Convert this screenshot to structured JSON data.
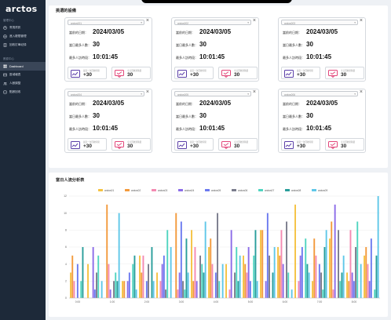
{
  "app": {
    "logo": "arctos"
  },
  "sidebar": {
    "sections": [
      {
        "label": "管理中心",
        "items": [
          {
            "label": "會員資訊",
            "icon": "user-icon"
          },
          {
            "label": "進入權限管理",
            "icon": "key-icon"
          },
          {
            "label": "回收訂單紀錄",
            "icon": "receipt-icon"
          }
        ]
      },
      {
        "label": "數據中心",
        "items": [
          {
            "label": "Dashboard",
            "icon": "dashboard-icon",
            "active": true
          },
          {
            "label": "區域報表",
            "icon": "report-icon"
          },
          {
            "label": "人數調整",
            "icon": "people-icon"
          },
          {
            "label": "點數回收",
            "icon": "recycle-icon"
          }
        ]
      }
    ]
  },
  "devices_panel": {
    "title": "挑選的設備",
    "labels": {
      "time": "當前的日期：",
      "visitors": "當日最多人數：",
      "peak": "最多人訪時段："
    },
    "cards": [
      {
        "device": "arctos001",
        "date": "2024/03/05",
        "visitors": "30",
        "peak": "10:01:45",
        "left_caption": "最近一次回收時間",
        "left_value": "+30",
        "right_caption": "今日回收累積量",
        "right_value": "30"
      },
      {
        "device": "arctos002",
        "date": "2024/03/05",
        "visitors": "30",
        "peak": "10:01:45",
        "left_caption": "最近一次回收時間",
        "left_value": "+30",
        "right_caption": "今日回收累積量",
        "right_value": "30"
      },
      {
        "device": "arctos003",
        "date": "2024/03/05",
        "visitors": "30",
        "peak": "10:01:45",
        "left_caption": "最近一次回收時間",
        "left_value": "+30",
        "right_caption": "今日回收累積量",
        "right_value": "30"
      },
      {
        "device": "arctos004",
        "date": "2024/03/05",
        "visitors": "30",
        "peak": "10:01:45",
        "left_caption": "最近一次回收時間",
        "left_value": "+30",
        "right_caption": "今日回收累積量",
        "right_value": "30"
      },
      {
        "device": "arctos005",
        "date": "2024/03/05",
        "visitors": "30",
        "peak": "10:01:45",
        "left_caption": "最近一次回收時間",
        "left_value": "+30",
        "right_caption": "今日回收累積量",
        "right_value": "30"
      },
      {
        "device": "arctos006",
        "date": "2024/03/05",
        "visitors": "30",
        "peak": "10:01:45",
        "left_caption": "最近一次回收時間",
        "left_value": "+30",
        "right_caption": "今日回收累積量",
        "right_value": "30"
      }
    ]
  },
  "chart_panel": {
    "title": "當日人流分析表"
  },
  "colors": {
    "sidebar_bg": "#1d2939",
    "accent_purple": "#5b3fa8",
    "accent_pink": "#e2467a",
    "series": [
      "#f5c242",
      "#f39a3c",
      "#f48ab2",
      "#8b6ce8",
      "#6b79ef",
      "#7a7c8c",
      "#4fd4c0",
      "#2a9e9b",
      "#5fc7e8"
    ]
  },
  "chart_data": {
    "type": "bar",
    "title": "",
    "xlabel": "",
    "ylabel": "",
    "ylim": [
      0,
      12
    ],
    "yticks": [
      0,
      2,
      4,
      6,
      8,
      10,
      12
    ],
    "categories": [
      "1:00",
      "2:00",
      "3:00",
      "4:00",
      "5:00",
      "6:00",
      "7:00",
      "8:00",
      "9:00",
      "10:00",
      "11:00",
      "12:00",
      "13:00",
      "14:00",
      "15:00",
      "16:00",
      "17:00",
      "18:00"
    ],
    "category_labels": [
      "0:00",
      "",
      "1:00",
      "",
      "2:00",
      "",
      "3:00",
      "",
      "4:00",
      "",
      "5:00",
      "",
      "6:00",
      "",
      "7:00",
      "",
      "8:00",
      ""
    ],
    "series": [
      {
        "name": "arctos01",
        "values": [
          3,
          4,
          0,
          2,
          5,
          3,
          0,
          8,
          6,
          4,
          5,
          8,
          6,
          11,
          2,
          7,
          3,
          5
        ]
      },
      {
        "name": "arctos02",
        "values": [
          5,
          0,
          11,
          2,
          3,
          0,
          10,
          2,
          7,
          0,
          4,
          8,
          5,
          0,
          7,
          9,
          2,
          6
        ]
      },
      {
        "name": "arctos03",
        "values": [
          2,
          0,
          4,
          0,
          5,
          2,
          1,
          6,
          4,
          1,
          3,
          0,
          8,
          2,
          5,
          1,
          8,
          4
        ]
      },
      {
        "name": "arctos04",
        "values": [
          0,
          6,
          1,
          2,
          0,
          4,
          3,
          2,
          0,
          8,
          6,
          2,
          4,
          5,
          0,
          11,
          3,
          2
        ]
      },
      {
        "name": "arctos05",
        "values": [
          4,
          1,
          0,
          3,
          2,
          5,
          9,
          0,
          3,
          0,
          2,
          10,
          0,
          6,
          4,
          0,
          2,
          7
        ]
      },
      {
        "name": "arctos06",
        "values": [
          0,
          3,
          2,
          0,
          4,
          1,
          2,
          5,
          10,
          3,
          0,
          5,
          9,
          0,
          3,
          8,
          6,
          0
        ]
      },
      {
        "name": "arctos07",
        "values": [
          2,
          5,
          3,
          4,
          0,
          8,
          1,
          4,
          2,
          6,
          5,
          0,
          3,
          7,
          1,
          2,
          9,
          1
        ]
      },
      {
        "name": "arctos08",
        "values": [
          6,
          0,
          2,
          5,
          6,
          0,
          7,
          3,
          0,
          2,
          8,
          3,
          0,
          4,
          6,
          3,
          0,
          5
        ]
      },
      {
        "name": "arctos09",
        "values": [
          0,
          2,
          10,
          1,
          2,
          6,
          3,
          9,
          4,
          5,
          2,
          6,
          1,
          3,
          8,
          5,
          4,
          12
        ]
      }
    ]
  }
}
